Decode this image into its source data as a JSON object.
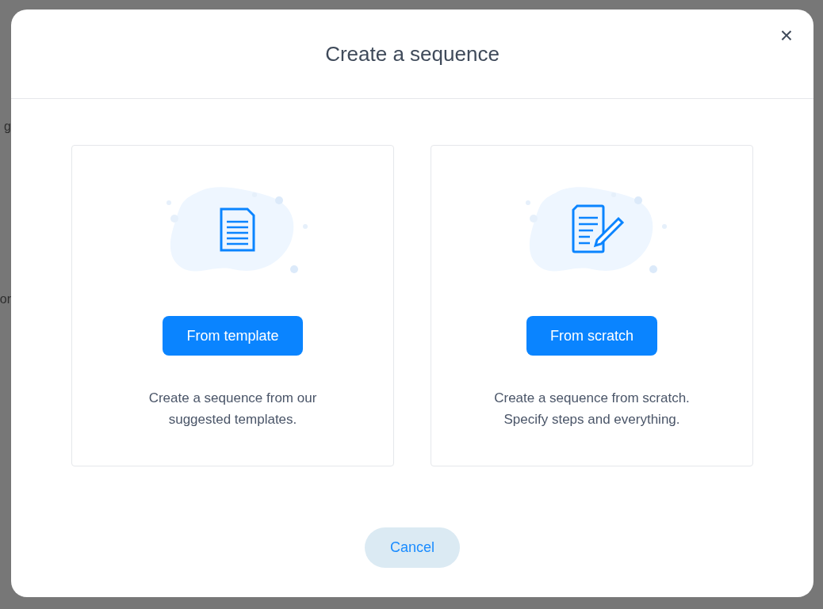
{
  "background_fragments": [
    "g",
    "or"
  ],
  "dialog": {
    "title": "Create a sequence",
    "close": "×",
    "options": [
      {
        "kind": "template",
        "button": "From template",
        "description_lines": [
          "Create a sequence from our",
          "suggested templates."
        ]
      },
      {
        "kind": "scratch",
        "button": "From scratch",
        "description_lines": [
          "Create a sequence from scratch.",
          "Specify steps and everything."
        ]
      }
    ],
    "cancel": "Cancel"
  }
}
